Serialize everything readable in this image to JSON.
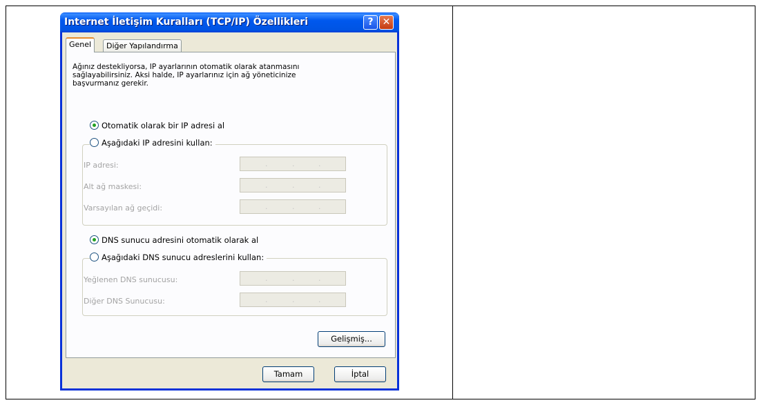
{
  "window": {
    "title": "Internet İletişim Kuralları (TCP/IP) Özellikleri",
    "help_glyph": "?",
    "close_glyph": "✕"
  },
  "tabs": [
    {
      "label": "Genel",
      "active": true
    },
    {
      "label": "Diğer Yapılandırma",
      "active": false
    }
  ],
  "general": {
    "description": "Ağınız destekliyorsa, IP ayarlarının otomatik olarak atanmasını\nsağlayabilirsiniz. Aksi halde, IP ayarlarınız için ağ yöneticinize\nbaşvurmanız gerekir.",
    "ip_auto_label": "Otomatik olarak bir IP adresi al",
    "ip_manual_label": "Aşağıdaki IP adresini kullan:",
    "ip_fields": [
      {
        "label": "IP adresi:",
        "value": ""
      },
      {
        "label": "Alt ağ maskesi:",
        "value": ""
      },
      {
        "label": "Varsayılan ağ geçidi:",
        "value": ""
      }
    ],
    "dns_auto_label": "DNS sunucu adresini otomatik olarak al",
    "dns_manual_label": "Aşağıdaki DNS sunucu adreslerini kullan:",
    "dns_fields": [
      {
        "label": "Yeğlenen DNS sunucusu:",
        "value": ""
      },
      {
        "label": "Diğer DNS Sunucusu:",
        "value": ""
      }
    ],
    "ip_mode": "auto",
    "dns_mode": "auto",
    "advanced_label": "Gelişmiş..."
  },
  "footer": {
    "ok_label": "Tamam",
    "cancel_label": "İptal"
  }
}
